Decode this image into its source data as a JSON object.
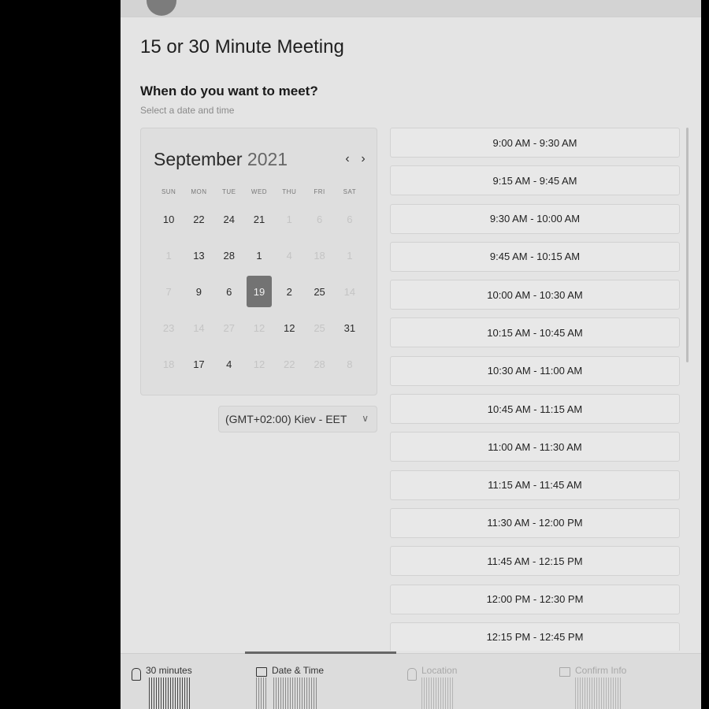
{
  "meeting": {
    "title": "15 or 30 Minute Meeting",
    "question": "When do you want to meet?",
    "hint": "Select a date and time"
  },
  "calendar": {
    "month": "September",
    "year": "2021",
    "prev_icon": "chevron-left-icon",
    "next_icon": "chevron-right-icon",
    "weekdays": [
      "SUN",
      "MON",
      "TUE",
      "WED",
      "THU",
      "FRI",
      "SAT"
    ],
    "days": [
      {
        "label": "10",
        "muted": false
      },
      {
        "label": "22",
        "muted": false
      },
      {
        "label": "24",
        "muted": false
      },
      {
        "label": "21",
        "muted": false
      },
      {
        "label": "1",
        "muted": true
      },
      {
        "label": "6",
        "muted": true
      },
      {
        "label": "6",
        "muted": true
      },
      {
        "label": "1",
        "muted": true
      },
      {
        "label": "13",
        "muted": false
      },
      {
        "label": "28",
        "muted": false
      },
      {
        "label": "1",
        "muted": false
      },
      {
        "label": "4",
        "muted": true
      },
      {
        "label": "18",
        "muted": true
      },
      {
        "label": "1",
        "muted": true
      },
      {
        "label": "7",
        "muted": true
      },
      {
        "label": "9",
        "muted": false
      },
      {
        "label": "6",
        "muted": false
      },
      {
        "label": "19",
        "muted": false,
        "selected": true
      },
      {
        "label": "2",
        "muted": false
      },
      {
        "label": "25",
        "muted": false
      },
      {
        "label": "14",
        "muted": true
      },
      {
        "label": "23",
        "muted": true
      },
      {
        "label": "14",
        "muted": true
      },
      {
        "label": "27",
        "muted": true
      },
      {
        "label": "12",
        "muted": true
      },
      {
        "label": "12",
        "muted": false
      },
      {
        "label": "25",
        "muted": true
      },
      {
        "label": "31",
        "muted": false
      },
      {
        "label": "18",
        "muted": true
      },
      {
        "label": "17",
        "muted": false
      },
      {
        "label": "4",
        "muted": false
      },
      {
        "label": "12",
        "muted": true
      },
      {
        "label": "22",
        "muted": true
      },
      {
        "label": "28",
        "muted": true
      },
      {
        "label": "8",
        "muted": true
      }
    ]
  },
  "timezone": {
    "label": "(GMT+02:00) Kiev - EET",
    "icon": "chevron-down-icon"
  },
  "time_slots": [
    "9:00 AM - 9:30 AM",
    "9:15 AM - 9:45 AM",
    "9:30 AM - 10:00 AM",
    "9:45 AM - 10:15 AM",
    "10:00 AM - 10:30 AM",
    "10:15 AM - 10:45 AM",
    "10:30 AM - 11:00 AM",
    "10:45 AM - 11:15 AM",
    "11:00 AM - 11:30 AM",
    "11:15 AM - 11:45 AM",
    "11:30 AM - 12:00 PM",
    "11:45 AM - 12:15 PM",
    "12:00 PM - 12:30 PM",
    "12:15 PM - 12:45 PM"
  ],
  "steps": {
    "duration": "30 minutes",
    "date_time": "Date & Time",
    "location": "Location",
    "confirm": "Confirm Info"
  }
}
